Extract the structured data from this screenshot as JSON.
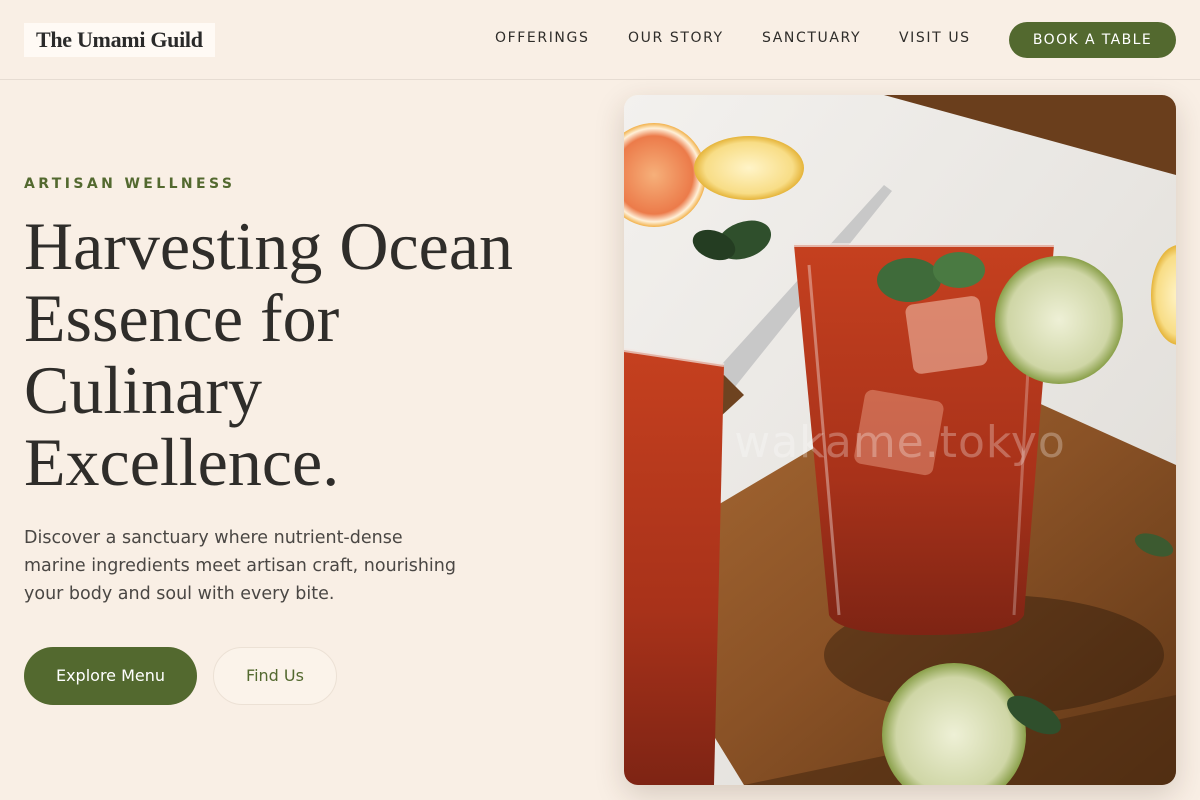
{
  "brand": {
    "name": "The Umami Guild"
  },
  "nav": {
    "items": [
      {
        "label": "OFFERINGS"
      },
      {
        "label": "OUR STORY"
      },
      {
        "label": "SANCTUARY"
      },
      {
        "label": "VISIT US"
      }
    ],
    "cta_label": "BOOK A TABLE"
  },
  "hero": {
    "eyebrow": "ARTISAN WELLNESS",
    "headline_lines": [
      "Harvesting Ocean",
      "Essence for",
      "Culinary",
      "Excellence."
    ],
    "description_lines": [
      "Discover a sanctuary where nutrient-dense",
      "marine ingredients meet artisan craft, nourishing",
      "your body and soul with every bite."
    ],
    "primary_button": "Explore Menu",
    "secondary_button": "Find Us",
    "image": {
      "watermark": "wakame.tokyo"
    }
  },
  "colors": {
    "background": "#f9efe5",
    "accent": "#53692f",
    "text": "#2f2d2a"
  }
}
